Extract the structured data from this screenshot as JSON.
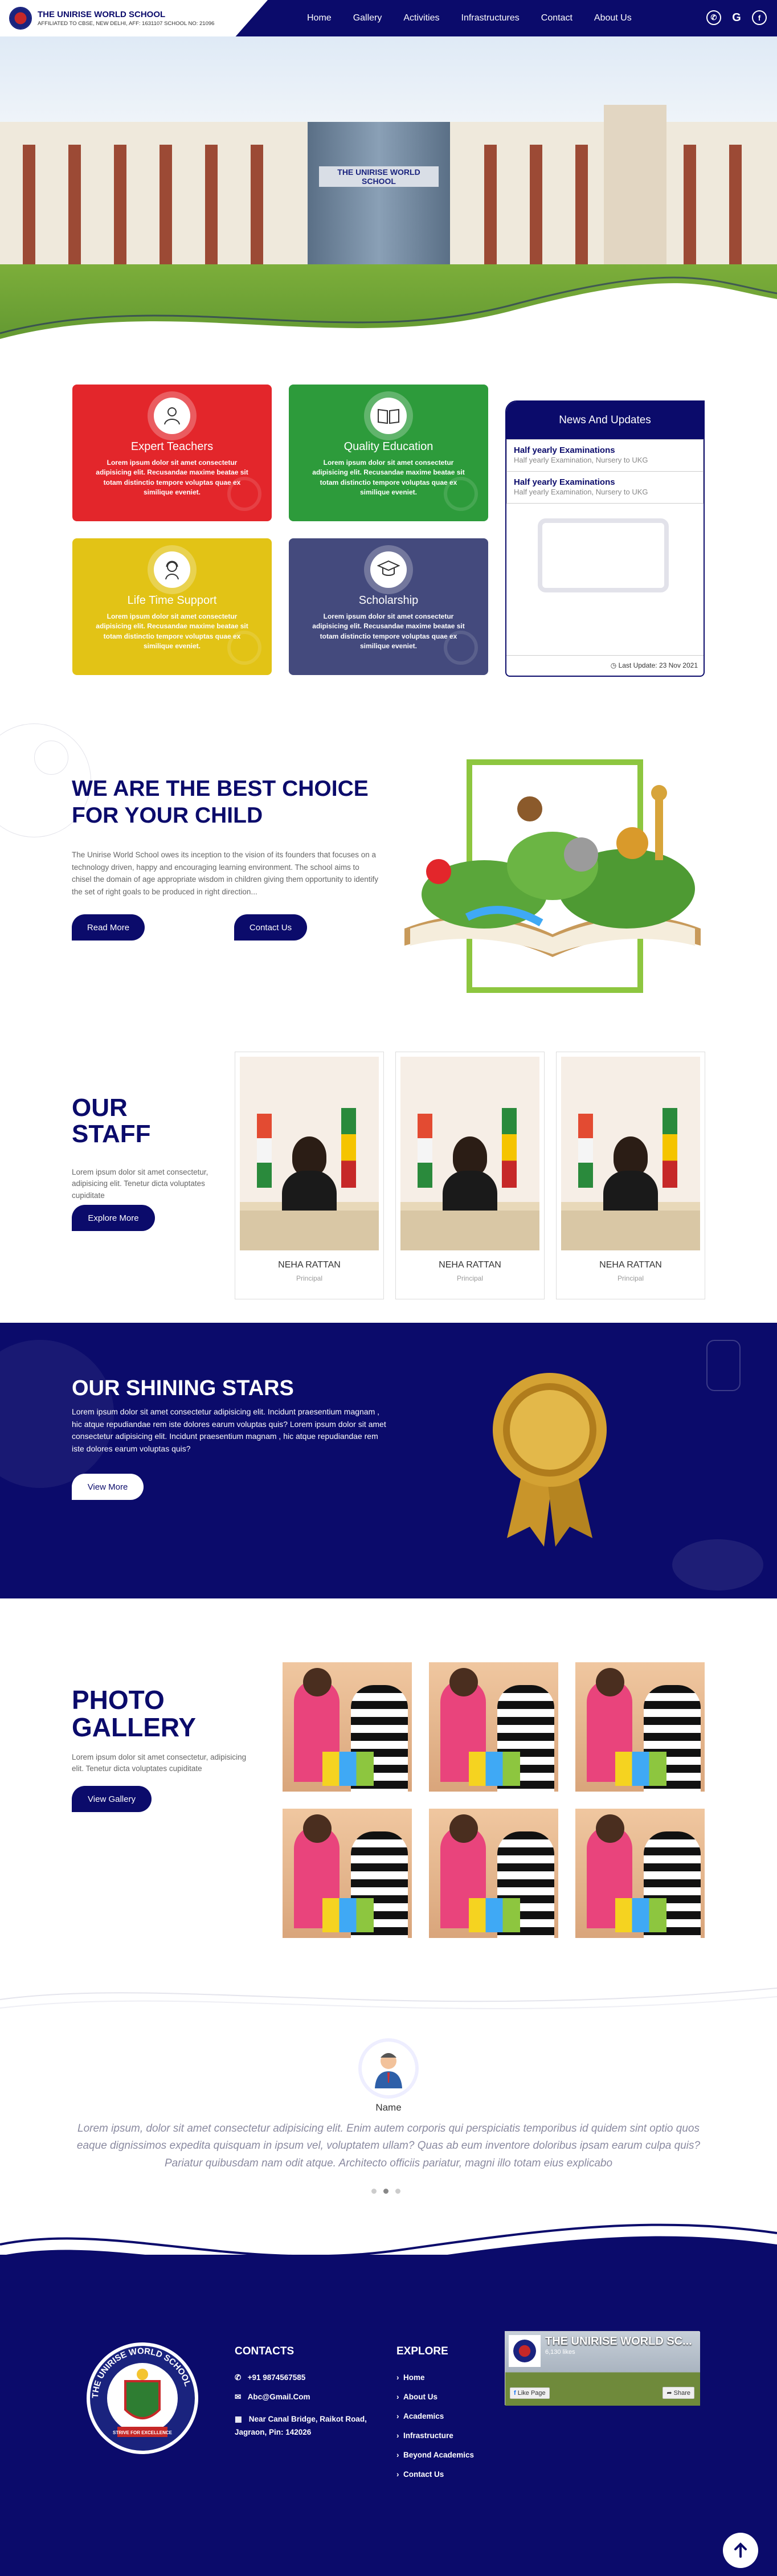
{
  "header": {
    "school_name": "THE UNIRISE WORLD SCHOOL",
    "affiliation": "AFFILIATED TO CBSE, NEW DELHI, AFF: 1631107 SCHOOL NO: 21096",
    "nav": [
      "Home",
      "Gallery",
      "Activities",
      "Infrastructures",
      "Contact",
      "About Us"
    ],
    "social_icons": [
      "whatsapp-icon",
      "google-icon",
      "facebook-icon"
    ]
  },
  "hero": {
    "building_sign": "THE UNIRISE WORLD SCHOOL"
  },
  "features": [
    {
      "title": "Expert Teachers",
      "text": "Lorem ipsum dolor sit amet consectetur adipisicing elit. Recusandae maxime beatae sit totam distinctio tempore voluptas quae ex similique eveniet.",
      "color": "#e3262b",
      "icon": "teacher-icon"
    },
    {
      "title": "Quality Education",
      "text": "Lorem ipsum dolor sit amet consectetur adipisicing elit. Recusandae maxime beatae sit totam distinctio tempore voluptas quae ex similique eveniet.",
      "color": "#2d9b3b",
      "icon": "open-book-icon"
    },
    {
      "title": "Life Time Support",
      "text": "Lorem ipsum dolor sit amet consectetur adipisicing elit. Recusandae maxime beatae sit totam distinctio tempore voluptas quae ex similique eveniet.",
      "color": "#e2c316",
      "icon": "support-icon"
    },
    {
      "title": "Scholarship",
      "text": "Lorem ipsum dolor sit amet consectetur adipisicing elit. Recusandae maxime beatae sit totam distinctio tempore voluptas quae ex similique eveniet.",
      "color": "#444a7d",
      "icon": "graduation-cap-icon"
    }
  ],
  "news": {
    "title": "News And Updates",
    "items": [
      {
        "title": "Half yearly Examinations",
        "sub": "Half yearly Examination, Nursery to UKG"
      },
      {
        "title": "Half yearly Examinations",
        "sub": "Half yearly Examination, Nursery to UKG"
      }
    ],
    "last_update": "Last Update: 23 Nov 2021"
  },
  "best": {
    "title_line1": "WE ARE THE BEST CHOICE",
    "title_line2": "FOR YOUR CHILD",
    "text": "The Unirise World School owes its inception to the vision of its founders that focuses on a technology driven, happy and encouraging learning environment. The school aims to chisel the domain of age appropriate wisdom in children giving them opportunity to identify the set of right goals to be produced in right direction...",
    "read_more": "Read More",
    "contact_us": "Contact Us"
  },
  "staff": {
    "title_line1": "OUR",
    "title_line2": "STAFF",
    "text": "Lorem ipsum dolor sit amet consectetur, adipisicing elit. Tenetur dicta voluptates cupiditate",
    "button": "Explore More",
    "members": [
      {
        "name": "NEHA RATTAN",
        "role": "Principal"
      },
      {
        "name": "NEHA RATTAN",
        "role": "Principal"
      },
      {
        "name": "NEHA RATTAN",
        "role": "Principal"
      }
    ]
  },
  "stars": {
    "title": "OUR SHINING STARS",
    "text": "Lorem ipsum dolor sit amet consectetur adipisicing elit. Incidunt praesentium magnam , hic atque repudiandae rem iste dolores earum voluptas quis? Lorem ipsum dolor sit amet consectetur adipisicing elit. Incidunt praesentium magnam , hic atque repudiandae rem iste dolores earum voluptas quis?",
    "button": "View More"
  },
  "gallery": {
    "title_line1": "PHOTO",
    "title_line2": "GALLERY",
    "text": "Lorem ipsum dolor sit amet consectetur, adipisicing elit. Tenetur dicta voluptates cupiditate",
    "button": "View Gallery"
  },
  "testimonial": {
    "name": "Name",
    "quote": "Lorem ipsum, dolor sit amet consectetur adipisicing elit. Enim autem corporis qui perspiciatis temporibus id quidem sint optio quos eaque dignissimos expedita quisquam in ipsum vel, voluptatem ullam? Quas ab eum inventore doloribus ipsam earum culpa quis? Pariatur quibusdam nam odit atque. Architecto officiis pariatur, magni illo totam eius explicabo"
  },
  "footer": {
    "contacts_title": "CONTACTS",
    "phone": "+91 9874567585",
    "email": "Abc@Gmail.Com",
    "address": "Near Canal Bridge, Raikot Road, Jagraon, Pin: 142026",
    "explore_title": "EXPLORE",
    "explore_links": [
      "Home",
      "About Us",
      "Academics",
      "Infrastructure",
      "Beyond Academics",
      "Contact Us"
    ],
    "fb": {
      "page_name": "THE UNIRISE WORLD SC...",
      "likes": "6,130 likes",
      "like_btn": "Like Page",
      "share_btn": "Share"
    },
    "logo_ring_text": "THE UNIRISE WORLD SCHOOL",
    "logo_motto": "STRIVE FOR EXCELLENCE"
  }
}
